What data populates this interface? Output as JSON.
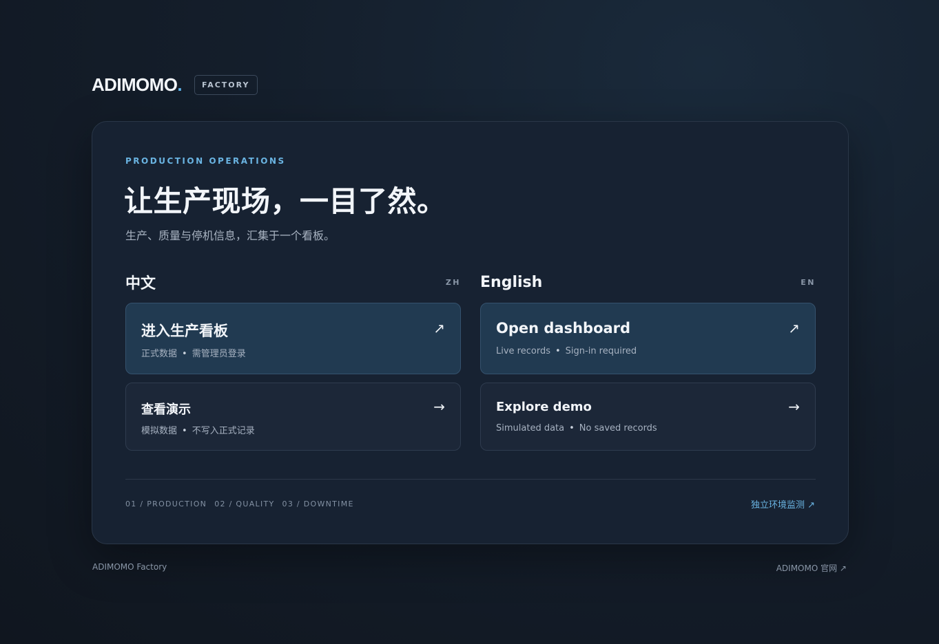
{
  "brand": {
    "logo_text": "ADIMOMO",
    "logo_dot": ".",
    "badge": "FACTORY"
  },
  "hero": {
    "eyebrow": "PRODUCTION OPERATIONS",
    "headline": "让生产现场，一目了然。",
    "subline": "生产、质量与停机信息，汇集于一个看板。"
  },
  "columns": {
    "zh": {
      "title": "中文",
      "code": "ZH",
      "primary": {
        "title": "进入生产看板",
        "meta_a": "正式数据",
        "meta_b": "需管理员登录",
        "arrow": "↗"
      },
      "secondary": {
        "title": "查看演示",
        "meta_a": "模拟数据",
        "meta_b": "不写入正式记录",
        "arrow": "→"
      }
    },
    "en": {
      "title": "English",
      "code": "EN",
      "primary": {
        "title": "Open dashboard",
        "meta_a": "Live records",
        "meta_b": "Sign-in required",
        "arrow": "↗"
      },
      "secondary": {
        "title": "Explore demo",
        "meta_a": "Simulated data",
        "meta_b": "No saved records",
        "arrow": "→"
      }
    }
  },
  "meta_separator": "•",
  "steps": [
    "01 / PRODUCTION",
    "02 / QUALITY",
    "03 / DOWNTIME"
  ],
  "monitor_link": "独立环境监测 ↗",
  "footer": {
    "left": "ADIMOMO Factory",
    "right": "ADIMOMO 官网 ↗"
  },
  "colors": {
    "accent": "#6ab4e2",
    "background": "#141e2b",
    "card": "#172232",
    "primary_button": "#213a51"
  }
}
